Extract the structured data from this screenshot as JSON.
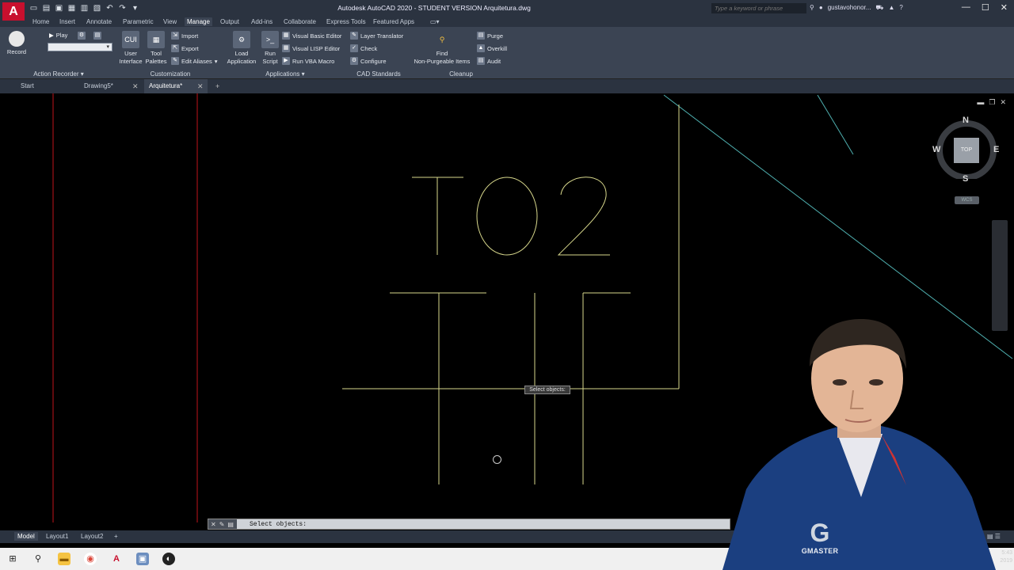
{
  "app": {
    "logo_letter": "A",
    "window_title": "Autodesk AutoCAD 2020 - STUDENT VERSION    Arquitetura.dwg",
    "search_placeholder": "Type a keyword or phrase",
    "username": "gustavohonor...",
    "win_min": "—",
    "win_max": "☐",
    "win_close": "✕"
  },
  "ribbon_tabs": [
    "Home",
    "Insert",
    "Annotate",
    "Parametric",
    "View",
    "Manage",
    "Output",
    "Add-ins",
    "Collaborate",
    "Express Tools",
    "Featured Apps"
  ],
  "active_ribbon_tab": "Manage",
  "ribbon": {
    "action_recorder": {
      "record": "Record",
      "play": "Play",
      "title": "Action Recorder"
    },
    "customization": {
      "user_interface": [
        "User",
        "Interface"
      ],
      "tool_palettes": [
        "Tool",
        "Palettes"
      ],
      "import": "Import",
      "export": "Export",
      "edit_aliases": "Edit Aliases",
      "title": "Customization"
    },
    "applications": {
      "load_application": [
        "Load",
        "Application"
      ],
      "run_script": [
        "Run",
        "Script"
      ],
      "vb_editor": "Visual Basic Editor",
      "lisp_editor": "Visual LISP Editor",
      "run_vba": "Run VBA Macro",
      "title": "Applications"
    },
    "cad_standards": {
      "layer_translator": "Layer Translator",
      "check": "Check",
      "configure": "Configure",
      "title": "CAD Standards"
    },
    "cleanup": {
      "find": [
        "Find",
        "Non-Purgeable Items"
      ],
      "purge": "Purge",
      "overkill": "Overkill",
      "audit": "Audit",
      "title": "Cleanup"
    }
  },
  "doc_tabs": [
    {
      "label": "Start"
    },
    {
      "label": "Drawing5*"
    },
    {
      "label": "Arquitetura*"
    }
  ],
  "doc_close": "✕",
  "doc_add": "+",
  "canvas": {
    "drawing_text": "TO2",
    "tooltip": "Select objects:",
    "viewcube": {
      "n": "N",
      "s": "S",
      "e": "E",
      "w": "W",
      "top": "TOP"
    },
    "wcs": "WCS"
  },
  "command_line": {
    "prompt": "Select objects:",
    "close_icon": "✕"
  },
  "layout_tabs": [
    "Model",
    "Layout1",
    "Layout2"
  ],
  "layout_add": "+",
  "taskbar": {
    "time": "5:43",
    "date": "2019"
  },
  "webcam": {
    "brand": "GMASTER"
  }
}
